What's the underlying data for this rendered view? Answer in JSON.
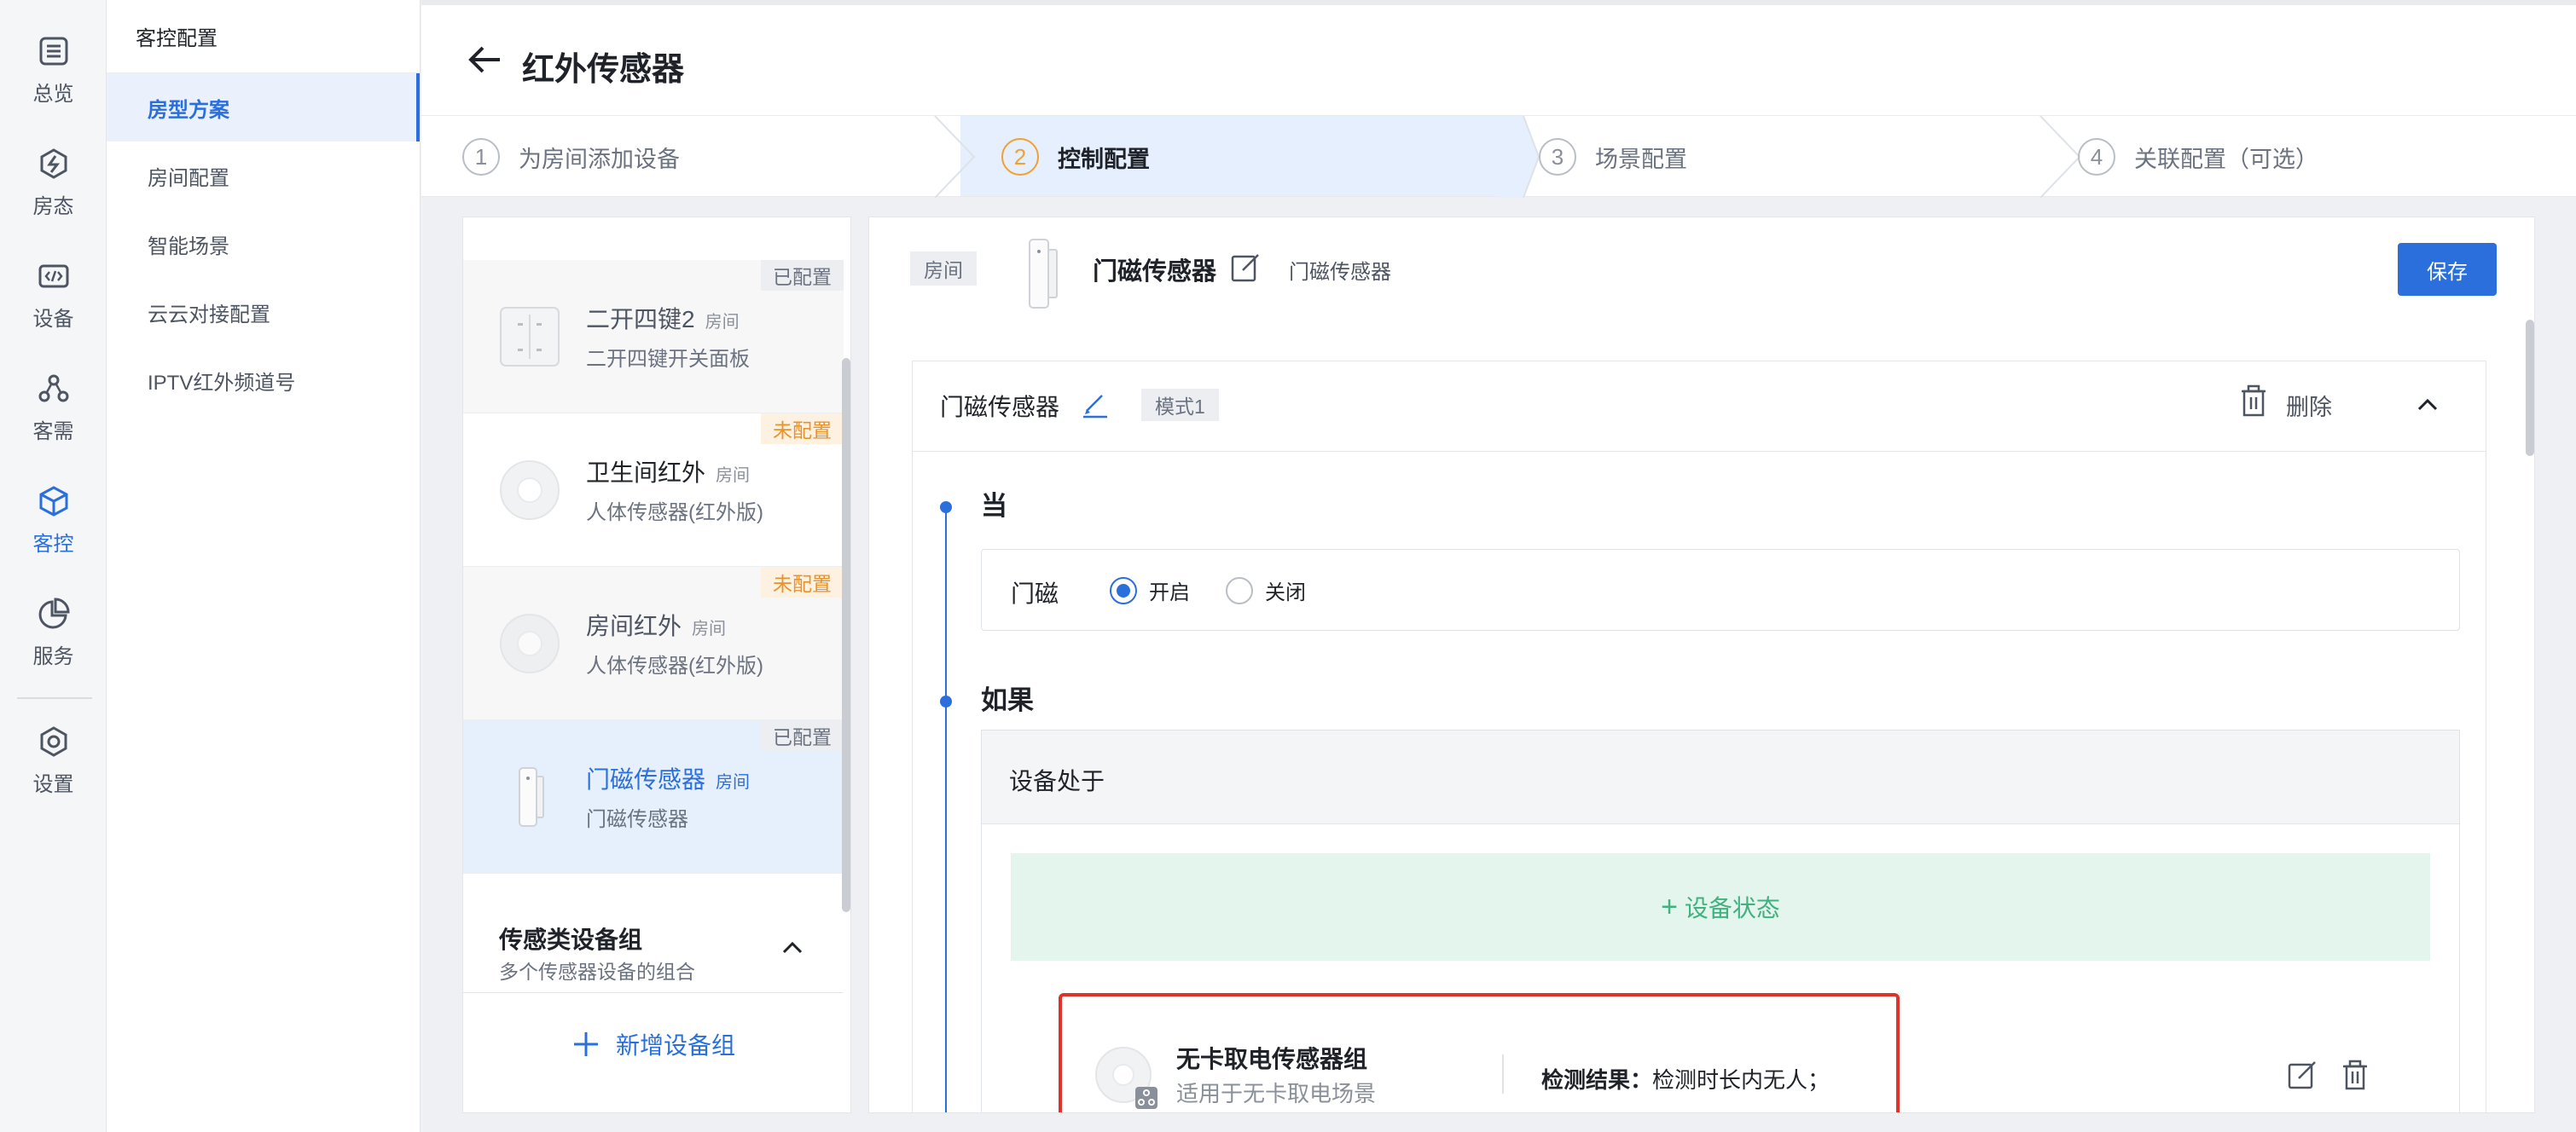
{
  "rail": {
    "items": [
      {
        "label": "总览",
        "icon": "list-icon"
      },
      {
        "label": "房态",
        "icon": "bolt-icon"
      },
      {
        "label": "设备",
        "icon": "code-icon"
      },
      {
        "label": "客需",
        "icon": "network-icon"
      },
      {
        "label": "客控",
        "icon": "cube-icon",
        "active": true
      },
      {
        "label": "服务",
        "icon": "pie-chart-icon"
      },
      {
        "label": "设置",
        "icon": "gear-icon"
      }
    ]
  },
  "subnav": {
    "title": "客控配置",
    "items": [
      {
        "label": "房型方案",
        "active": true
      },
      {
        "label": "房间配置"
      },
      {
        "label": "智能场景"
      },
      {
        "label": "云云对接配置"
      },
      {
        "label": "IPTV红外频道号"
      }
    ]
  },
  "header": {
    "title": "红外传感器"
  },
  "stepper": {
    "steps": [
      {
        "num": "1",
        "label": "为房间添加设备"
      },
      {
        "num": "2",
        "label": "控制配置",
        "active": true
      },
      {
        "num": "3",
        "label": "场景配置"
      },
      {
        "num": "4",
        "label": "关联配置（可选）"
      }
    ]
  },
  "devices": [
    {
      "name": "二开四键2",
      "room": "房间",
      "sub": "二开四键开关面板",
      "badge": "已配置",
      "state": "dim"
    },
    {
      "name": "卫生间红外",
      "room": "房间",
      "sub": "人体传感器(红外版)",
      "badge": "未配置",
      "state": "normal"
    },
    {
      "name": "房间红外",
      "room": "房间",
      "sub": "人体传感器(红外版)",
      "badge": "未配置",
      "state": "dim"
    },
    {
      "name": "门磁传感器",
      "room": "房间",
      "sub": "门磁传感器",
      "badge": "已配置",
      "state": "selected"
    }
  ],
  "group": {
    "title": "传感类设备组",
    "subtitle": "多个传感器设备的组合",
    "add_label": "新增设备组"
  },
  "main": {
    "room_tag": "房间",
    "device_name": "门磁传感器",
    "device_type": "门磁传感器",
    "save_label": "保存",
    "rule": {
      "name": "门磁传感器",
      "mode": "模式1",
      "delete_label": "删除",
      "when_title": "当",
      "when_label": "门磁",
      "options": [
        {
          "label": "开启",
          "checked": true
        },
        {
          "label": "关闭",
          "checked": false
        }
      ],
      "if_title": "如果",
      "if_head": "设备处于",
      "add_state": "设备状态",
      "sensor": {
        "name": "无卡取电传感器组",
        "sub": "适用于无卡取电场景",
        "result_label": "检测结果：",
        "result_value": "检测时长内无人；"
      }
    }
  },
  "colors": {
    "accent": "#2a6fdb",
    "warning": "#e8922a",
    "success": "#3fb27f",
    "highlight": "#e0322b"
  }
}
